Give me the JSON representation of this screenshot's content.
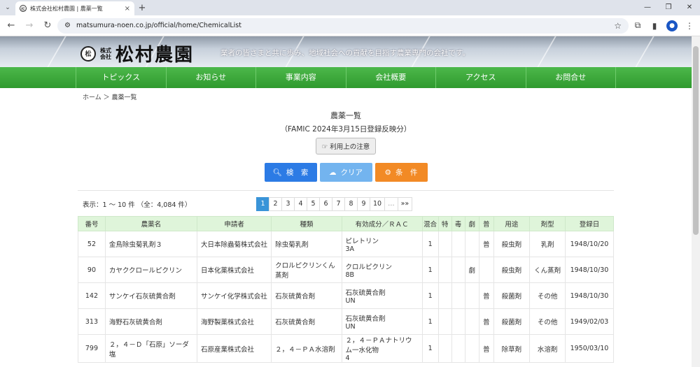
{
  "browser": {
    "tab_title": "株式会社松村農園 | 農薬一覧",
    "url": "matsumura-noen.co.jp/official/home/ChemicalList"
  },
  "site": {
    "logo_small": "株式会社",
    "logo_name": "松村農園",
    "tagline": "業者の皆さまと共に歩み、地域社会への貢献を目指す農業専門の会社です。",
    "nav": [
      "トピックス",
      "お知らせ",
      "事業内容",
      "会社概要",
      "アクセス",
      "お問合せ"
    ]
  },
  "breadcrumb": "ホーム ＞ 農薬一覧",
  "page_title": "農薬一覧",
  "page_sub": "（FAMIC 2024年3月15日登録反映分）",
  "notice_button": "利用上の注意",
  "actions": {
    "search": "検　索",
    "clear": "クリア",
    "condition": "条　件"
  },
  "result_count": "表示：1 ～ 10 件 （全：4,084 件）",
  "pager": [
    "1",
    "2",
    "3",
    "4",
    "5",
    "6",
    "7",
    "8",
    "9",
    "10",
    "…",
    "»»"
  ],
  "table": {
    "headers": [
      "番号",
      "農薬名",
      "申請者",
      "種類",
      "有効成分／ＲＡＣ",
      "混合",
      "特",
      "毒",
      "劇",
      "普",
      "用途",
      "剤型",
      "登録日"
    ],
    "rows": [
      {
        "no": "52",
        "name": "金鳥除虫菊乳剤３",
        "applicant": "大日本除蟲菊株式会社",
        "kind": "除虫菊乳剤",
        "ingredient": "ピレトリン",
        "rac": "3A",
        "mix": "1",
        "toku": "",
        "doku": "",
        "geki": "",
        "fu": "普",
        "use": "殺虫剤",
        "form": "乳剤",
        "date": "1948/10/20"
      },
      {
        "no": "90",
        "name": "カヤククロールピクリン",
        "applicant": "日本化薬株式会社",
        "kind": "クロルピクリンくん蒸剤",
        "ingredient": "クロルピクリン",
        "rac": "8B",
        "mix": "1",
        "toku": "",
        "doku": "",
        "geki": "劇",
        "fu": "",
        "use": "殺虫剤",
        "form": "くん蒸剤",
        "date": "1948/10/30"
      },
      {
        "no": "142",
        "name": "サンケイ石灰硫黄合剤",
        "applicant": "サンケイ化学株式会社",
        "kind": "石灰硫黄合剤",
        "ingredient": "石灰硫黄合剤",
        "rac": "UN",
        "mix": "1",
        "toku": "",
        "doku": "",
        "geki": "",
        "fu": "普",
        "use": "殺菌剤",
        "form": "その他",
        "date": "1948/10/30"
      },
      {
        "no": "313",
        "name": "海野石灰硫黄合剤",
        "applicant": "海野製薬株式会社",
        "kind": "石灰硫黄合剤",
        "ingredient": "石灰硫黄合剤",
        "rac": "UN",
        "mix": "1",
        "toku": "",
        "doku": "",
        "geki": "",
        "fu": "普",
        "use": "殺菌剤",
        "form": "その他",
        "date": "1949/02/03"
      },
      {
        "no": "799",
        "name": "２，４－Ｄ「石原」ソーダ塩",
        "applicant": "石原産業株式会社",
        "kind": "２，４－ＰＡ水溶剤",
        "ingredient": "２，４－ＰＡナトリウム一水化物",
        "rac": "4",
        "mix": "1",
        "toku": "",
        "doku": "",
        "geki": "",
        "fu": "普",
        "use": "除草剤",
        "form": "水溶剤",
        "date": "1950/03/10"
      }
    ]
  }
}
